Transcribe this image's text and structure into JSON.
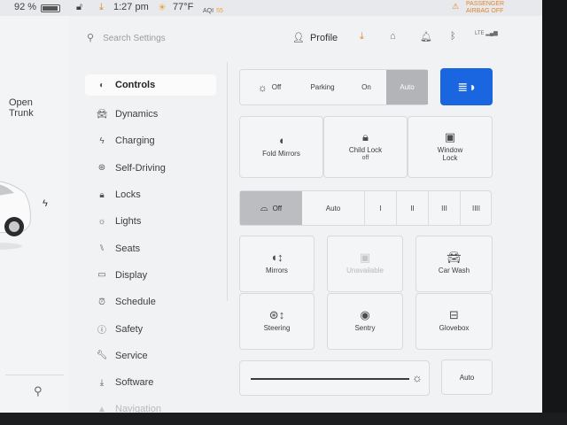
{
  "status_bar": {
    "battery_percent": "92 %",
    "battery_level": 0.92,
    "time": "1:27 pm",
    "temperature": "77°F",
    "aqi_label": "AQI",
    "aqi_value": "55",
    "airbag_line1": "PASSENGER",
    "airbag_line2": "AIRBAG OFF"
  },
  "car_panel": {
    "trunk_line1": "Open",
    "trunk_line2": "Trunk"
  },
  "header": {
    "search_placeholder": "Search Settings",
    "profile_label": "Profile",
    "lte_label": "LTE"
  },
  "menu": {
    "items": [
      {
        "label": "Controls",
        "icon": "toggle-icon"
      },
      {
        "label": "Dynamics",
        "icon": "car-icon"
      },
      {
        "label": "Charging",
        "icon": "bolt-icon"
      },
      {
        "label": "Self-Driving",
        "icon": "steering-wheel-icon"
      },
      {
        "label": "Locks",
        "icon": "lock-icon"
      },
      {
        "label": "Lights",
        "icon": "light-icon"
      },
      {
        "label": "Seats",
        "icon": "seat-icon"
      },
      {
        "label": "Display",
        "icon": "display-icon"
      },
      {
        "label": "Schedule",
        "icon": "alarm-clock-icon"
      },
      {
        "label": "Safety",
        "icon": "info-circle-icon"
      },
      {
        "label": "Service",
        "icon": "wrench-icon"
      },
      {
        "label": "Software",
        "icon": "download-icon"
      },
      {
        "label": "Navigation",
        "icon": "navigation-arrow-icon"
      }
    ]
  },
  "lights_mode": {
    "options": [
      "Off",
      "Parking",
      "On",
      "Auto"
    ],
    "selected": "Auto"
  },
  "closures": {
    "fold_mirrors": "Fold Mirrors",
    "child_lock": "Child Lock",
    "child_lock_state": "off",
    "window_lock": "Window\nLock"
  },
  "wipers": {
    "options": [
      "Off",
      "Auto",
      "I",
      "II",
      "III",
      "IIII"
    ],
    "selected": "Off"
  },
  "quick_tiles": {
    "mirrors": "Mirrors",
    "unavailable": "Unavailable",
    "car_wash": "Car Wash",
    "steering": "Steering",
    "sentry": "Sentry",
    "glovebox": "Glovebox"
  },
  "brightness": {
    "level": 0.95,
    "auto_label": "Auto"
  }
}
